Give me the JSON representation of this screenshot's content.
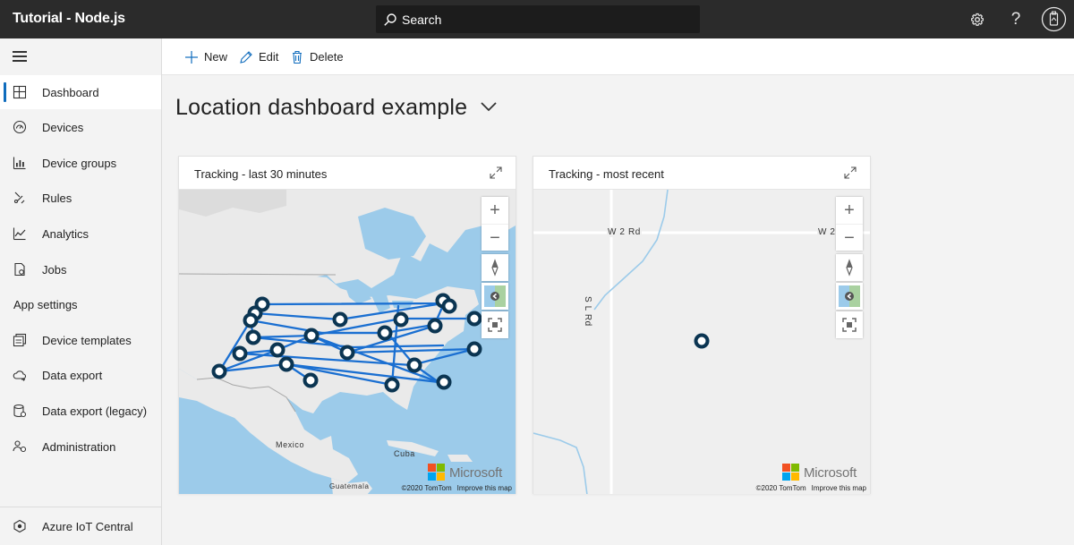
{
  "header": {
    "app_title": "Tutorial - Node.js",
    "search_label": "Search",
    "icons": [
      "settings-icon",
      "help-icon",
      "avatar-icon"
    ],
    "help_glyph": "?"
  },
  "sidebar": {
    "items": [
      {
        "label": "Dashboard",
        "icon": "dashboard-icon",
        "active": true
      },
      {
        "label": "Devices",
        "icon": "devices-icon"
      },
      {
        "label": "Device groups",
        "icon": "device-groups-icon"
      },
      {
        "label": "Rules",
        "icon": "rules-icon"
      },
      {
        "label": "Analytics",
        "icon": "analytics-icon"
      },
      {
        "label": "Jobs",
        "icon": "jobs-icon"
      }
    ],
    "section_title": "App settings",
    "settings_items": [
      {
        "label": "Device templates",
        "icon": "device-templates-icon"
      },
      {
        "label": "Data export",
        "icon": "data-export-icon"
      },
      {
        "label": "Data export (legacy)",
        "icon": "data-export-legacy-icon"
      },
      {
        "label": "Administration",
        "icon": "administration-icon"
      }
    ],
    "footer": {
      "label": "Azure IoT Central",
      "icon": "iot-central-icon"
    }
  },
  "toolbar": {
    "new_label": "New",
    "edit_label": "Edit",
    "delete_label": "Delete"
  },
  "dashboard": {
    "title": "Location dashboard example"
  },
  "tiles": [
    {
      "title": "Tracking - last 30 minutes",
      "map_labels": {
        "mexico": "Mexico",
        "cuba": "Cuba",
        "guatemala": "Guatemala"
      },
      "logo_text": "Microsoft",
      "copyright": "©2020 TomTom",
      "improve": "Improve this map"
    },
    {
      "title": "Tracking - most recent",
      "road_labels": {
        "w2rd": "W 2 Rd",
        "w2": "W 2",
        "slrd": "S L Rd"
      },
      "logo_text": "Microsoft",
      "copyright": "©2020 TomTom",
      "improve": "Improve this map"
    }
  ],
  "colors": {
    "accent": "#0f6cbd",
    "water": "#9ccbea",
    "land": "#eaeaea",
    "route": "#1a6fd1",
    "marker": "#0b3552",
    "ms_red": "#f25022",
    "ms_green": "#7fba00",
    "ms_blue": "#00a4ef",
    "ms_yellow": "#ffb900"
  }
}
